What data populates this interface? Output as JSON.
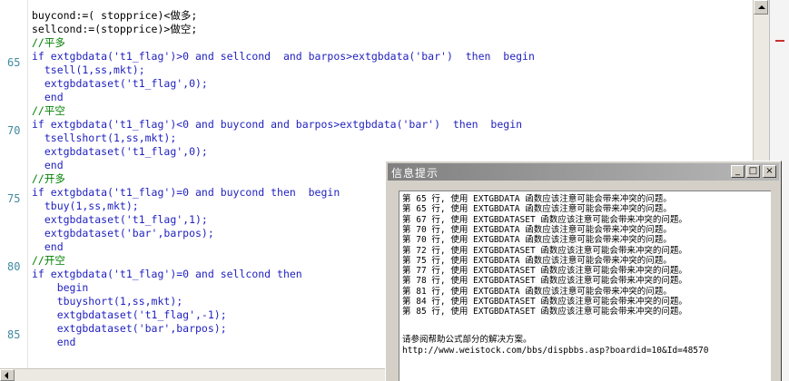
{
  "editor": {
    "gutter_numbers": [
      "65",
      "70",
      "75",
      "80",
      "85"
    ],
    "lines": [
      {
        "text": "buycond:=( stopprice)<做多;",
        "kind": "normal"
      },
      {
        "text": "sellcond:=(stopprice)>做空;",
        "kind": "normal"
      },
      {
        "text": "//平多",
        "kind": "comment"
      },
      {
        "text": "if extgbdata('t1_flag')>0 and sellcond  and barpos>extgbdata('bar')  then  begin",
        "kind": "blue"
      },
      {
        "text": "  tsell(1,ss,mkt);",
        "kind": "blue"
      },
      {
        "text": "  extgbdataset('t1_flag',0);",
        "kind": "blue"
      },
      {
        "text": "  end",
        "kind": "blue"
      },
      {
        "text": "//平空",
        "kind": "comment"
      },
      {
        "text": "if extgbdata('t1_flag')<0 and buycond and barpos>extgbdata('bar')  then  begin",
        "kind": "blue"
      },
      {
        "text": "  tsellshort(1,ss,mkt);",
        "kind": "blue"
      },
      {
        "text": "  extgbdataset('t1_flag',0);",
        "kind": "blue"
      },
      {
        "text": "  end",
        "kind": "blue"
      },
      {
        "text": "//开多",
        "kind": "comment"
      },
      {
        "text": "if extgbdata('t1_flag')=0 and buycond then  begin",
        "kind": "blue"
      },
      {
        "text": "  tbuy(1,ss,mkt);",
        "kind": "blue"
      },
      {
        "text": "  extgbdataset('t1_flag',1);",
        "kind": "blue"
      },
      {
        "text": "  extgbdataset('bar',barpos);",
        "kind": "blue"
      },
      {
        "text": "  end",
        "kind": "blue"
      },
      {
        "text": "//开空",
        "kind": "comment"
      },
      {
        "text": "if extgbdata('t1_flag')=0 and sellcond then",
        "kind": "blue"
      },
      {
        "text": "    begin",
        "kind": "blue"
      },
      {
        "text": "    tbuyshort(1,ss,mkt);",
        "kind": "blue"
      },
      {
        "text": "    extgbdataset('t1_flag',-1);",
        "kind": "blue"
      },
      {
        "text": "    extgbdataset('bar',barpos);",
        "kind": "blue"
      },
      {
        "text": "    end",
        "kind": "blue"
      }
    ]
  },
  "dialog": {
    "title": "信息提示",
    "buttons": {
      "minimize": "_",
      "maximize": "□",
      "close": "×"
    },
    "messages": [
      "第 65 行, 使用 EXTGBDATA 函数应该注意可能会带来冲突的问题。",
      "第 65 行, 使用 EXTGBDATA 函数应该注意可能会带来冲突的问题。",
      "第 67 行, 使用 EXTGBDATASET 函数应该注意可能会带来冲突的问题。",
      "第 70 行, 使用 EXTGBDATA 函数应该注意可能会带来冲突的问题。",
      "第 70 行, 使用 EXTGBDATA 函数应该注意可能会带来冲突的问题。",
      "第 72 行, 使用 EXTGBDATASET 函数应该注意可能会带来冲突的问题。",
      "第 75 行, 使用 EXTGBDATA 函数应该注意可能会带来冲突的问题。",
      "第 77 行, 使用 EXTGBDATASET 函数应该注意可能会带来冲突的问题。",
      "第 78 行, 使用 EXTGBDATASET 函数应该注意可能会带来冲突的问题。",
      "第 81 行, 使用 EXTGBDATA 函数应该注意可能会带来冲突的问题。",
      "第 84 行, 使用 EXTGBDATASET 函数应该注意可能会带来冲突的问题。",
      "第 85 行, 使用 EXTGBDATASET 函数应该注意可能会带来冲突的问题。"
    ],
    "help_text": "请参阅帮助公式部分的解决方案。",
    "help_url": "http://www.weistock.com/bbs/dispbbs.asp?boardid=10&Id=48570"
  },
  "colors": {
    "code_blue": "#1f1fbf",
    "comment_green": "#008000",
    "gutter_teal": "#3f8aa0"
  }
}
